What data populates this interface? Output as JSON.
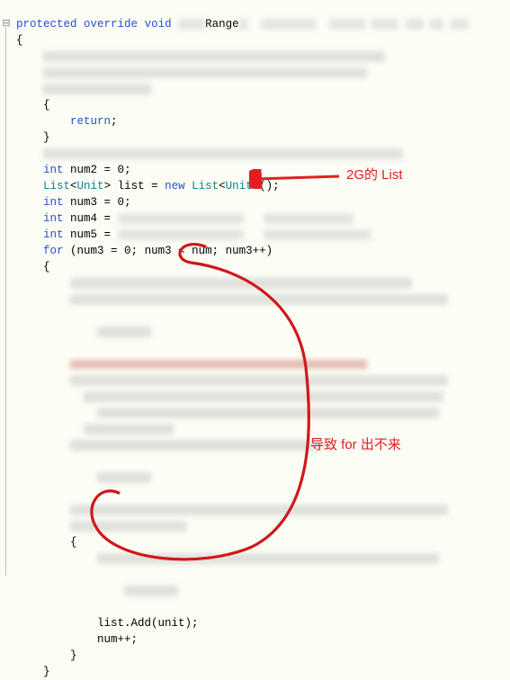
{
  "code": {
    "line1_kw1": "protected",
    "line1_kw2": "override",
    "line1_kw3": "void",
    "line1_method": "Range",
    "line2": "{",
    "line6": "{",
    "line7_return": "return",
    "line7_semi": ";",
    "line8": "}",
    "num2_decl_kw": "int",
    "num2_decl": " num2 = ",
    "zero": "0",
    "semi": ";",
    "list_decl_type1": "List",
    "list_decl_lt": "<",
    "list_decl_type2": "Unit",
    "list_decl_gt": ">",
    "list_decl_name": " list = ",
    "new_kw": "new",
    "list_ctor": " List",
    "list_ctor_end": "();",
    "num3_decl_kw": "int",
    "num3_decl": " num3 = ",
    "num4_decl_kw": "int",
    "num4_decl": " num4 = ",
    "num5_decl_kw": "int",
    "num5_decl": " num5 = ",
    "for_kw": "for",
    "for_body": " (num3 = ",
    "for_body2": "; num3 < num; num3++)",
    "brace_open": "{",
    "inner_brace_open": "{",
    "list_add": "list.Add(unit);",
    "num_inc": "num++;",
    "inner_brace_close": "}",
    "brace_close": "}"
  },
  "annotations": {
    "a1": "2G的 List",
    "a2": "导致 for 出不来"
  },
  "gutter": {
    "fold": "⊟"
  }
}
